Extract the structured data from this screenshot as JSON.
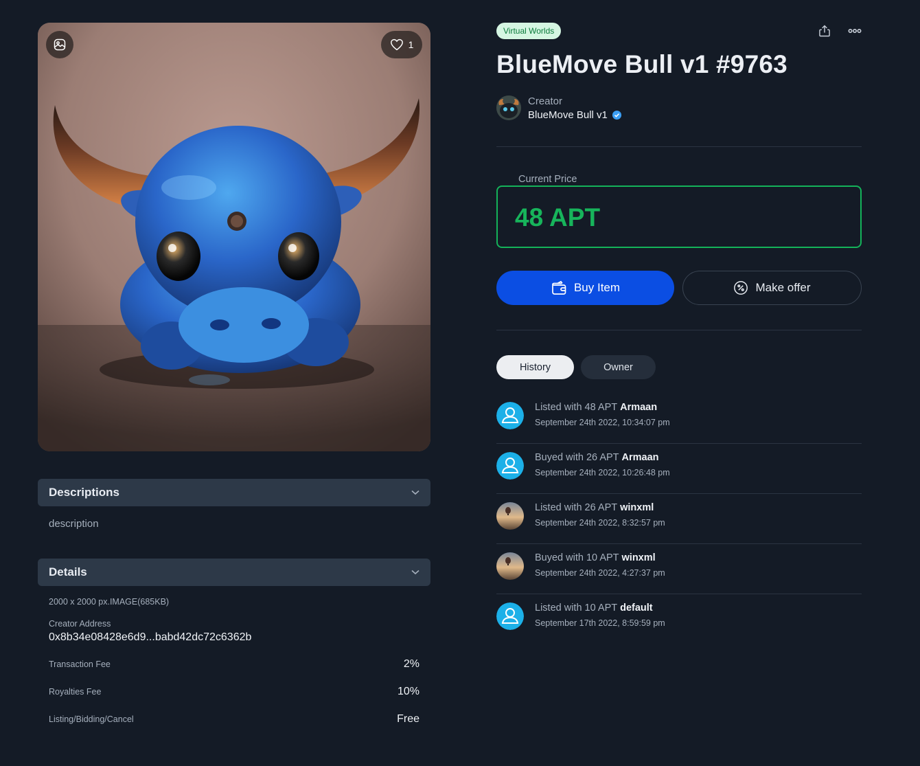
{
  "media": {
    "like_count": "1"
  },
  "descriptions": {
    "heading": "Descriptions",
    "text": "description"
  },
  "details": {
    "heading": "Details",
    "file_info": "2000 x 2000 px.IMAGE(685KB)",
    "creator_address_label": "Creator Address",
    "creator_address": "0x8b34e08428e6d9...babd42dc72c6362b",
    "fees": [
      {
        "label": "Transaction Fee",
        "value": "2%"
      },
      {
        "label": "Royalties Fee",
        "value": "10%"
      },
      {
        "label": "Listing/Bidding/Cancel",
        "value": "Free"
      }
    ]
  },
  "item": {
    "tag": "Virtual Worlds",
    "title": "BlueMove Bull v1 #9763",
    "creator_label": "Creator",
    "creator_name": "BlueMove Bull v1"
  },
  "price": {
    "label": "Current Price",
    "value": "48 APT"
  },
  "actions": {
    "buy_label": "Buy Item",
    "offer_label": "Make offer"
  },
  "tabs": {
    "history": "History",
    "owner": "Owner"
  },
  "history": [
    {
      "action": "Listed with 48 APT",
      "user": "Armaan",
      "date": "September 24th 2022, 10:34:07 pm",
      "avatar": "default-user-icon"
    },
    {
      "action": "Buyed with 26 APT",
      "user": "Armaan",
      "date": "September 24th 2022, 10:26:48 pm",
      "avatar": "default-user-icon"
    },
    {
      "action": "Listed with 26 APT",
      "user": "winxml",
      "date": "September 24th 2022, 8:32:57 pm",
      "avatar": "balloon-avatar"
    },
    {
      "action": "Buyed with 10 APT",
      "user": "winxml",
      "date": "September 24th 2022, 4:27:37 pm",
      "avatar": "balloon-avatar"
    },
    {
      "action": "Listed with 10 APT",
      "user": "default",
      "date": "September 17th 2022, 8:59:59 pm",
      "avatar": "default-user-icon"
    }
  ],
  "colors": {
    "accent_blue": "#0b4ee3",
    "price_green": "#17b45b",
    "background": "#141b26"
  }
}
